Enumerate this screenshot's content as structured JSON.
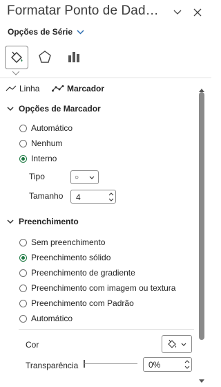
{
  "pane": {
    "title": "Formatar Ponto de Dad…",
    "series_options_label": "Opções de Série"
  },
  "subtabs": {
    "line_label": "Linha",
    "marker_label": "Marcador"
  },
  "marker_options": {
    "section_title": "Opções de Marcador",
    "radio_automatic": "Automático",
    "radio_none": "Nenhum",
    "radio_builtin": "Interno",
    "selected": "Interno",
    "type_label": "Tipo",
    "type_value": "○",
    "size_label": "Tamanho",
    "size_value": "4"
  },
  "fill": {
    "section_title": "Preenchimento",
    "radio_no_fill": "Sem preenchimento",
    "radio_solid": "Preenchimento sólido",
    "radio_gradient": "Preenchimento de gradiente",
    "radio_picture": "Preenchimento com imagem ou textura",
    "radio_pattern": "Preenchimento com Padrão",
    "radio_automatic": "Automático",
    "selected": "Preenchimento sólido",
    "color_label": "Cor",
    "transparency_label": "Transparência",
    "transparency_value": "0%",
    "transparency_level_percent": 0
  },
  "colors": {
    "accent": "#1f7a44",
    "chevron": "#2b6cb0",
    "icon": "#444444"
  }
}
